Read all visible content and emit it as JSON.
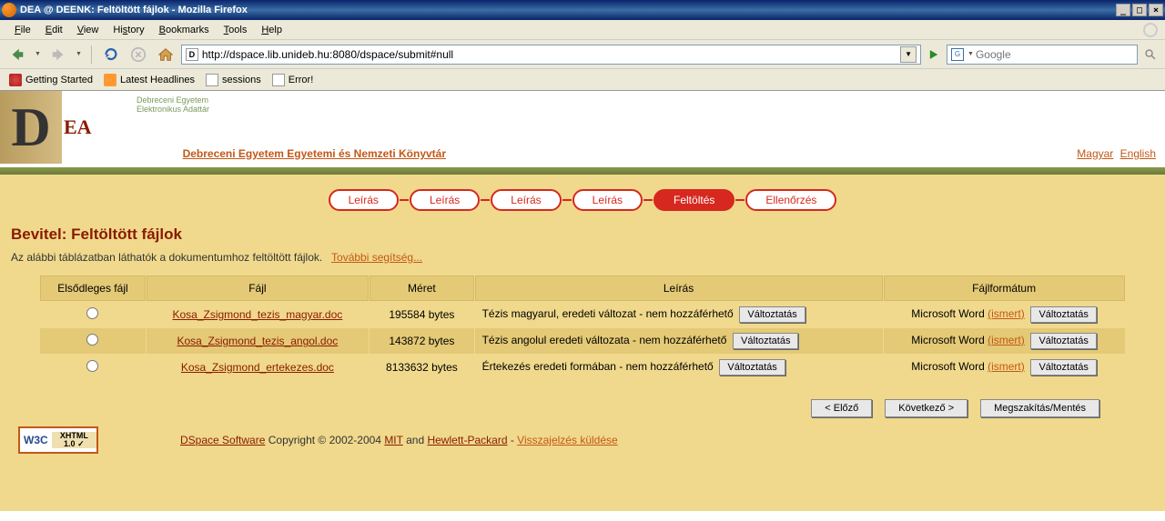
{
  "window": {
    "title": "DEA @ DEENK: Feltöltött fájlok - Mozilla Firefox"
  },
  "menubar": {
    "file": "File",
    "edit": "Edit",
    "view": "View",
    "history": "History",
    "bookmarks": "Bookmarks",
    "tools": "Tools",
    "help": "Help"
  },
  "url": "http://dspace.lib.unideb.hu:8080/dspace/submit#null",
  "search_placeholder": "Google",
  "bookmarks": {
    "getting_started": "Getting Started",
    "latest_headlines": "Latest Headlines",
    "sessions": "sessions",
    "error": "Error!"
  },
  "header": {
    "logo_d": "D",
    "logo_ea": "EA",
    "logo_sub1": "Debreceni Egyetem",
    "logo_sub2": "Elektronikus Adattár",
    "library_link": "Debreceni Egyetem Egyetemi és Nemzeti Könyvtár",
    "lang_hu": "Magyar",
    "lang_en": "English"
  },
  "steps": {
    "s1": "Leírás",
    "s2": "Leírás",
    "s3": "Leírás",
    "s4": "Leírás",
    "s5": "Feltöltés",
    "s6": "Ellenőrzés"
  },
  "page": {
    "title": "Bevitel: Feltöltött fájlok",
    "desc": "Az alábbi táblázatban láthatók a dokumentumhoz feltöltött fájlok.",
    "more_help": "További segítség..."
  },
  "table": {
    "headers": {
      "primary": "Elsődleges fájl",
      "file": "Fájl",
      "size": "Méret",
      "desc": "Leírás",
      "format": "Fájlformátum"
    },
    "change_btn": "Változtatás",
    "format_text": "Microsoft Word",
    "ismert": "(ismert)",
    "rows": [
      {
        "file": "Kosa_Zsigmond_tezis_magyar.doc",
        "size": "195584 bytes",
        "desc": "Tézis magyarul, eredeti változat - nem hozzáférhető"
      },
      {
        "file": "Kosa_Zsigmond_tezis_angol.doc",
        "size": "143872 bytes",
        "desc": "Tézis angolul eredeti változata - nem hozzáférhető"
      },
      {
        "file": "Kosa_Zsigmond_ertekezes.doc",
        "size": "8133632 bytes",
        "desc": "Értekezés eredeti formában - nem hozzáférhető"
      }
    ]
  },
  "nav": {
    "prev": "< Előző",
    "next": "Következő >",
    "cancel": "Megszakítás/Mentés"
  },
  "footer": {
    "w3c_l": "W3C",
    "w3c_r": "XHTML 1.0",
    "dspace": "DSpace Software",
    "copyright": " Copyright © 2002-2004 ",
    "mit": "MIT",
    "and": " and ",
    "hp": "Hewlett-Packard",
    "dash": " - ",
    "feedback": "Visszajelzés küldése"
  }
}
